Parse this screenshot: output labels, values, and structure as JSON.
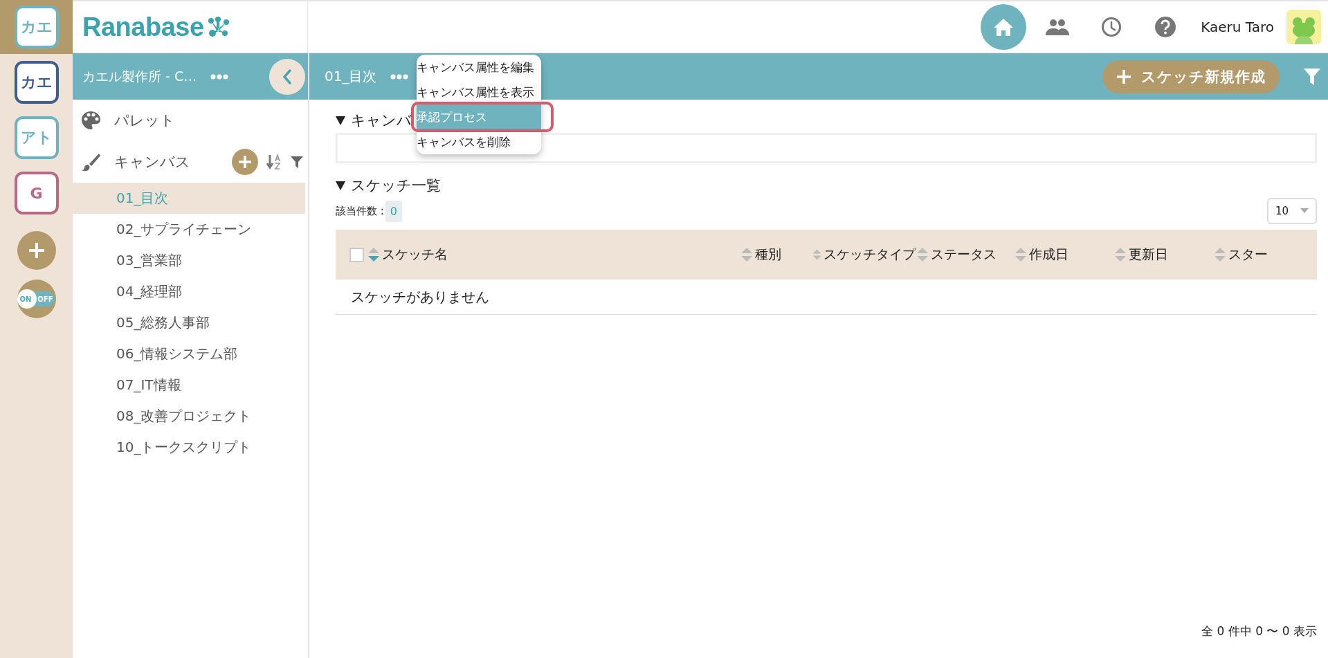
{
  "workspaces": [
    {
      "label": "カエ",
      "color": "#6fb3bf",
      "selected": true
    },
    {
      "label": "カエ",
      "color": "#3e5f8f",
      "selected": false
    },
    {
      "label": "アト",
      "color": "#6fb3bf",
      "selected": false
    },
    {
      "label": "G",
      "color": "#b86a85",
      "selected": false
    }
  ],
  "toggle": {
    "on_label": "ON",
    "off_label": "OFF",
    "on": true
  },
  "header": {
    "logo": "Ranabase",
    "user_name": "Kaeru Taro",
    "nav": [
      {
        "kind": "home",
        "selected": true
      },
      {
        "kind": "people",
        "selected": false
      },
      {
        "kind": "history",
        "selected": false
      },
      {
        "kind": "help",
        "selected": false
      }
    ]
  },
  "sidebar": {
    "title": "カエル製作所 - C…",
    "sections": [
      {
        "kind": "palette",
        "label": "パレット"
      },
      {
        "kind": "canvas",
        "label": "キャンバス"
      }
    ],
    "canvases": [
      {
        "label": "01_目次",
        "selected": true
      },
      {
        "label": "02_サプライチェーン",
        "selected": false
      },
      {
        "label": "03_営業部",
        "selected": false
      },
      {
        "label": "04_経理部",
        "selected": false
      },
      {
        "label": "05_総務人事部",
        "selected": false
      },
      {
        "label": "06_情報システム部",
        "selected": false
      },
      {
        "label": "07_IT情報",
        "selected": false
      },
      {
        "label": "08_改善プロジェクト",
        "selected": false
      },
      {
        "label": "10_トークスクリプト",
        "selected": false
      }
    ]
  },
  "main": {
    "title": "01_目次",
    "new_button": "スケッチ新規作成",
    "menu": [
      {
        "label": "キャンバス属性を編集",
        "selected": false,
        "marked": false
      },
      {
        "label": "キャンバス属性を表示",
        "selected": false,
        "marked": false
      },
      {
        "label": "承認プロセス",
        "selected": true,
        "marked": true
      },
      {
        "label": "キャンバスを削除",
        "selected": false,
        "marked": false
      }
    ],
    "attributes_section": {
      "title": "キャンバ",
      "expanded": true
    },
    "sketches_section": {
      "title": "スケッチ一覧",
      "expanded": true,
      "count_label": "該当件数 :",
      "count": "0",
      "page_size": "10",
      "columns": [
        {
          "label": "スケッチ名",
          "sorted": true
        },
        {
          "label": "種別",
          "sorted": false
        },
        {
          "label": "スケッチタイプ",
          "sorted": false
        },
        {
          "label": "ステータス",
          "sorted": false
        },
        {
          "label": "作成日",
          "sorted": false
        },
        {
          "label": "更新日",
          "sorted": false
        },
        {
          "label": "スター",
          "sorted": false
        }
      ],
      "select_all_checked": false,
      "empty_message": "スケッチがありません",
      "footer": "全 0 件中 0 〜 0 表示"
    }
  }
}
